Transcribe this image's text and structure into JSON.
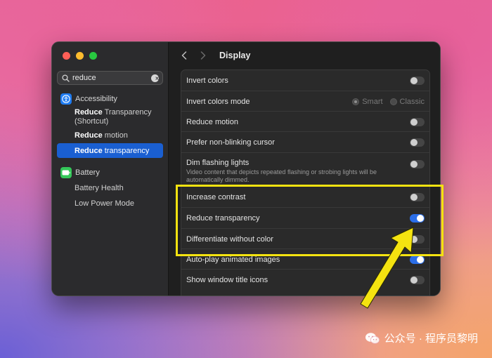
{
  "window": {
    "title": "Display"
  },
  "search": {
    "value": "reduce"
  },
  "sidebar": {
    "accessibility": {
      "label": "Accessibility",
      "items": [
        {
          "bold": "Reduce",
          "rest": " Transparency",
          "line2": "(Shortcut)"
        },
        {
          "bold": "Reduce",
          "rest": " motion"
        },
        {
          "bold": "Reduce",
          "rest": " transparency"
        }
      ]
    },
    "battery": {
      "label": "Battery",
      "items": [
        "Battery Health",
        "Low Power Mode"
      ]
    }
  },
  "settings": {
    "invert_colors": {
      "label": "Invert colors",
      "on": false
    },
    "invert_colors_mode": {
      "label": "Invert colors mode",
      "options": [
        "Smart",
        "Classic"
      ],
      "selected": "Smart"
    },
    "reduce_motion": {
      "label": "Reduce motion",
      "on": false
    },
    "non_blinking_cursor": {
      "label": "Prefer non-blinking cursor",
      "on": false
    },
    "dim_flashing": {
      "label": "Dim flashing lights",
      "description": "Video content that depicts repeated flashing or strobing lights will be automatically dimmed.",
      "on": false
    },
    "increase_contrast": {
      "label": "Increase contrast",
      "on": false
    },
    "reduce_transparency": {
      "label": "Reduce transparency",
      "on": true
    },
    "differentiate_without_color": {
      "label": "Differentiate without color",
      "on": false
    },
    "autoplay_images": {
      "label": "Auto-play animated images",
      "on": true
    },
    "window_title_icons": {
      "label": "Show window title icons",
      "on": false
    }
  },
  "watermark": {
    "text": "公众号 · 程序员黎明"
  },
  "colors": {
    "accent": "#1a5fd1",
    "toggle_on": "#2b6ee8",
    "highlight": "#f4e310"
  }
}
